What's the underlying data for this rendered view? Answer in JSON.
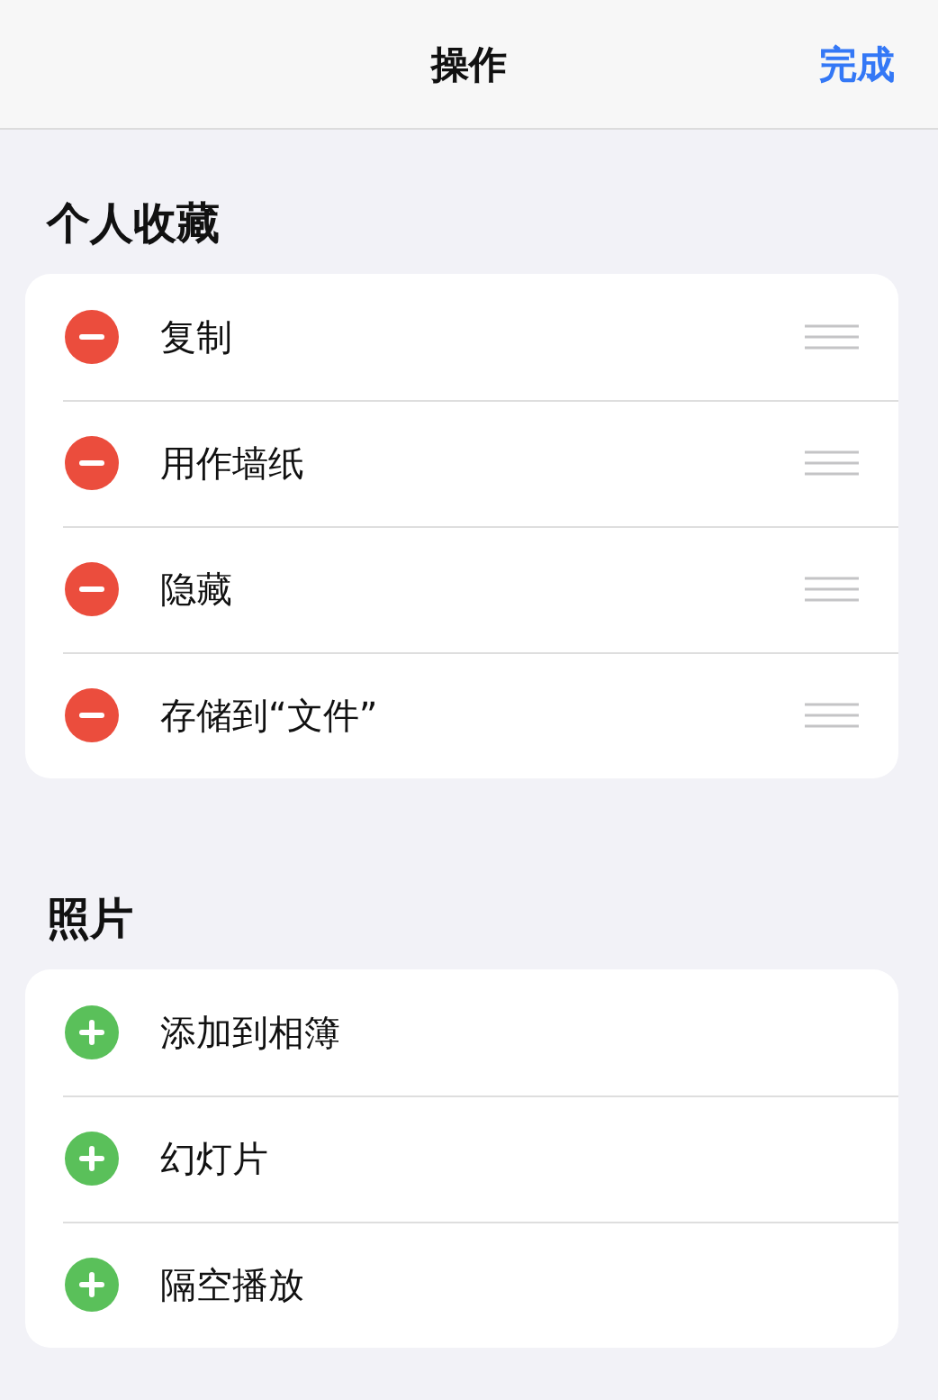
{
  "nav_bar": {
    "title": "操作",
    "done_button": "完成"
  },
  "sections": [
    {
      "title": "个人收藏",
      "items": [
        {
          "label": "复制",
          "kind": "remove"
        },
        {
          "label": "用作墙纸",
          "kind": "remove"
        },
        {
          "label": "隐藏",
          "kind": "remove"
        },
        {
          "label": "存储到“文件”",
          "kind": "remove"
        }
      ]
    },
    {
      "title": "照片",
      "items": [
        {
          "label": "添加到相簿",
          "kind": "add"
        },
        {
          "label": "幻灯片",
          "kind": "add"
        },
        {
          "label": "隔空播放",
          "kind": "add"
        }
      ]
    }
  ]
}
